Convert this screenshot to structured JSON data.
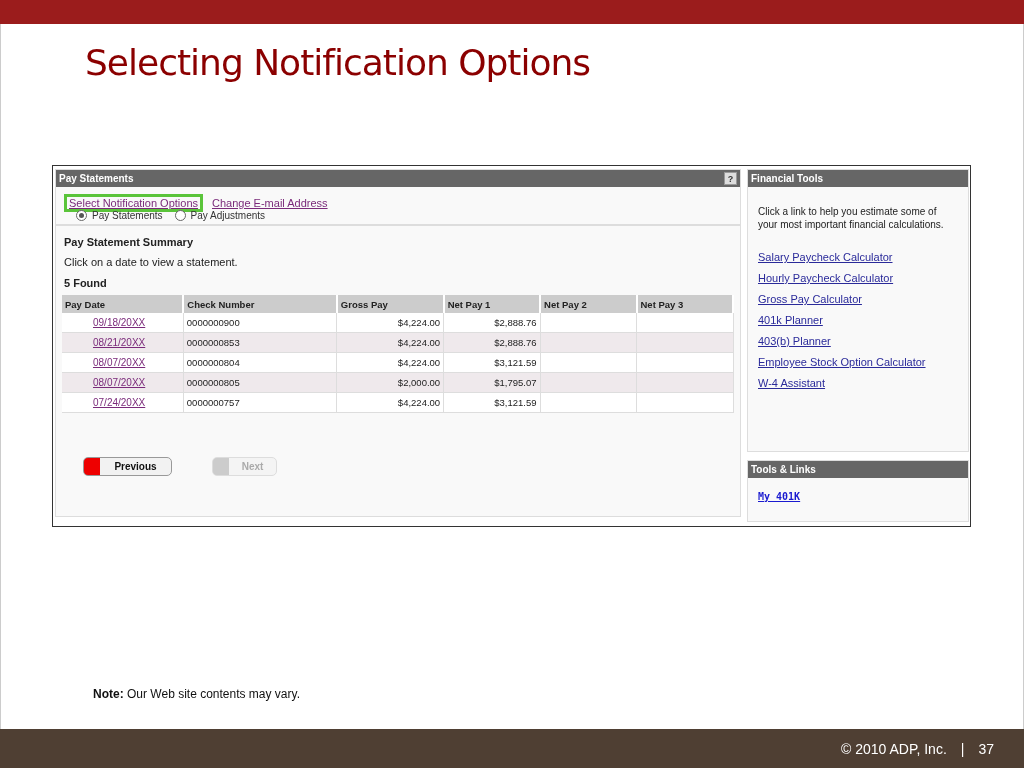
{
  "slide": {
    "title": "Selecting Notification Options",
    "note_label": "Note:",
    "note_text": "Our Web site contents may vary.",
    "footer": {
      "copyright": "© 2010 ADP, Inc.",
      "separator": "|",
      "page": "37"
    }
  },
  "pay_statements": {
    "title": "Pay Statements",
    "help": "?",
    "links": [
      {
        "label": "Select Notification Options",
        "highlighted": true
      },
      {
        "label": "Change E-mail Address",
        "highlighted": false
      }
    ],
    "radios": [
      {
        "label": "Pay Statements",
        "selected": true
      },
      {
        "label": "Pay Adjustments",
        "selected": false
      }
    ],
    "summary_title": "Pay Statement Summary",
    "instruction": "Click on a date to view a statement.",
    "found": "5  Found",
    "table": {
      "columns": [
        "Pay Date",
        "Check Number",
        "Gross Pay",
        "Net Pay 1",
        "Net Pay 2",
        "Net Pay 3"
      ],
      "rows": [
        [
          "09/18/20XX",
          "0000000900",
          "$4,224.00",
          "$2,888.76",
          "",
          ""
        ],
        [
          "08/21/20XX",
          "0000000853",
          "$4,224.00",
          "$2,888.76",
          "",
          ""
        ],
        [
          "08/07/20XX",
          "0000000804",
          "$4,224.00",
          "$3,121.59",
          "",
          ""
        ],
        [
          "08/07/20XX",
          "0000000805",
          "$2,000.00",
          "$1,795.07",
          "",
          ""
        ],
        [
          "07/24/20XX",
          "0000000757",
          "$4,224.00",
          "$3,121.59",
          "",
          ""
        ]
      ]
    },
    "buttons": [
      {
        "label": "Previous",
        "disabled": false
      },
      {
        "label": "Next",
        "disabled": true
      }
    ]
  },
  "financial_tools": {
    "title": "Financial Tools",
    "intro": "Click a link to help you estimate some of your most important financial calculations.",
    "links": [
      "Salary Paycheck Calculator",
      "Hourly Paycheck Calculator",
      "Gross Pay Calculator",
      "401k Planner",
      "403(b) Planner",
      "Employee Stock Option Calculator",
      "W-4 Assistant"
    ]
  },
  "tools_links": {
    "title": "Tools & Links",
    "links": [
      "My 401K"
    ]
  }
}
